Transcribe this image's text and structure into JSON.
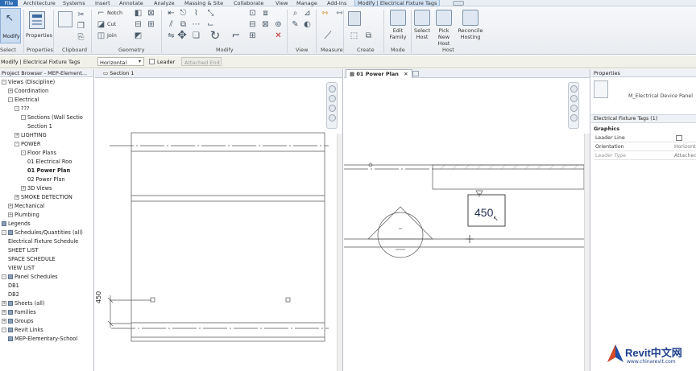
{
  "menubar": {
    "items": [
      "File",
      "Architecture",
      "Systems",
      "Insert",
      "Annotate",
      "Analyze",
      "Massing & Site",
      "Collaborate",
      "View",
      "Manage",
      "Add-Ins",
      "Modify | Electrical Fixture Tags"
    ]
  },
  "ribbon": {
    "modify_label": "Modify",
    "properties_label": "Properties",
    "panels": {
      "select": "Select",
      "properties": "Properties",
      "clipboard": "Clipboard",
      "geometry": "Geometry",
      "modify": "Modify",
      "view": "View",
      "measure": "Measure",
      "create": "Create",
      "mode": "Mode",
      "host": "Host"
    },
    "geometry_tools": [
      "Notch",
      "Cut",
      "Join"
    ],
    "mode_buttons": [
      {
        "label1": "Edit",
        "label2": "Family"
      },
      {
        "label1": "Select",
        "label2": "Host"
      },
      {
        "label1": "Pick New",
        "label2": "Host"
      },
      {
        "label1": "Reconcile",
        "label2": "Hosting"
      }
    ]
  },
  "optionsbar": {
    "context": "Modify | Electrical Fixture Tags",
    "orientation": "Horizontal",
    "leader_label": "Leader",
    "attached_end": "Attached End"
  },
  "project_browser": {
    "title": "Project Browser - MEP-Element...",
    "items": [
      {
        "label": "Views (Discipline)",
        "level": 0,
        "toggle": "-",
        "bold": false
      },
      {
        "label": "Coordination",
        "level": 1,
        "toggle": "+"
      },
      {
        "label": "Electrical",
        "level": 1,
        "toggle": "-"
      },
      {
        "label": "???",
        "level": 2,
        "toggle": "-"
      },
      {
        "label": "Sections (Wall Sectio",
        "level": 3,
        "toggle": "-"
      },
      {
        "label": "Section 1",
        "level": 4,
        "toggle": ""
      },
      {
        "label": "LIGHTING",
        "level": 2,
        "toggle": "+"
      },
      {
        "label": "POWER",
        "level": 2,
        "toggle": "-"
      },
      {
        "label": "Floor Plans",
        "level": 3,
        "toggle": "-"
      },
      {
        "label": "01 Electrical Roo",
        "level": 4,
        "toggle": ""
      },
      {
        "label": "01 Power Plan",
        "level": 4,
        "toggle": "",
        "bold": true
      },
      {
        "label": "02 Power Plan",
        "level": 4,
        "toggle": ""
      },
      {
        "label": "3D Views",
        "level": 3,
        "toggle": "+"
      },
      {
        "label": "SMOKE DETECTION",
        "level": 2,
        "toggle": "+"
      },
      {
        "label": "Mechanical",
        "level": 1,
        "toggle": "+"
      },
      {
        "label": "Plumbing",
        "level": 1,
        "toggle": "+"
      },
      {
        "label": "Legends",
        "level": 0,
        "toggle": "",
        "icon": true
      },
      {
        "label": "Schedules/Quantities (all)",
        "level": 0,
        "toggle": "-",
        "icon": true
      },
      {
        "label": "Electrical Fixture Schedule",
        "level": 1,
        "toggle": ""
      },
      {
        "label": "SHEET LIST",
        "level": 1,
        "toggle": ""
      },
      {
        "label": "SPACE SCHEDULE",
        "level": 1,
        "toggle": ""
      },
      {
        "label": "VIEW LIST",
        "level": 1,
        "toggle": ""
      },
      {
        "label": "Panel Schedules",
        "level": 0,
        "toggle": "-",
        "icon": true
      },
      {
        "label": "DB1",
        "level": 1,
        "toggle": ""
      },
      {
        "label": "DB2",
        "level": 1,
        "toggle": ""
      },
      {
        "label": "Sheets (all)",
        "level": 0,
        "toggle": "+",
        "icon": true
      },
      {
        "label": "Families",
        "level": 0,
        "toggle": "+",
        "icon": true
      },
      {
        "label": "Groups",
        "level": 0,
        "toggle": "+",
        "icon": true
      },
      {
        "label": "Revit Links",
        "level": 0,
        "toggle": "-",
        "icon": true
      },
      {
        "label": "MEP-Elementary-School",
        "level": 1,
        "toggle": "",
        "icon": true
      }
    ]
  },
  "view_section": {
    "tab": "Section 1",
    "dimension": "450"
  },
  "view_plan": {
    "tab": "01 Power Plan",
    "tag_value": "450"
  },
  "properties": {
    "title": "Properties",
    "type_name": "M_Electrical Device Panel",
    "selector": "Electrical Fixture Tags (1)",
    "group": "Graphics",
    "rows": [
      {
        "k": "Leader Line",
        "v": ""
      },
      {
        "k": "Orientation",
        "v": "Horizontal"
      },
      {
        "k": "Leader Type",
        "v": "Attached End"
      }
    ]
  },
  "watermark": {
    "brand": "Revit中文网",
    "url": "www.chinarevit.com"
  }
}
